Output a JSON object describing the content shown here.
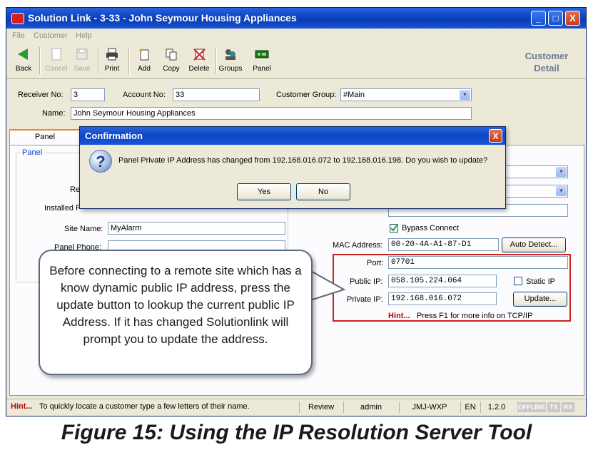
{
  "window": {
    "title": "Solution Link - 3-33 - John Seymour Housing Appliances",
    "min_btn": "_",
    "max_btn": "□",
    "close_btn": "X"
  },
  "menu": {
    "file": "File",
    "customer": "Customer",
    "help": "Help"
  },
  "toolbar": {
    "back": "Back",
    "cancel": "Cancel",
    "save": "Save",
    "print": "Print",
    "add": "Add",
    "copy": "Copy",
    "delete": "Delete",
    "groups": "Groups",
    "panel": "Panel",
    "customer_detail_1": "Customer",
    "customer_detail_2": "Detail"
  },
  "header_form": {
    "receiver_label": "Receiver No:",
    "receiver_value": "3",
    "account_label": "Account No:",
    "account_value": "33",
    "group_label": "Customer Group:",
    "group_value": "#Main",
    "name_label": "Name:",
    "name_value": "John Seymour Housing Appliances"
  },
  "tabs": {
    "panel": "Panel"
  },
  "panel_group": {
    "title": "Panel",
    "label_partial_1": "I",
    "label_partial_2": "Re",
    "installed_label": "Installed P",
    "site_name_label": "Site Name:",
    "site_name_value": "MyAlarm",
    "phone_label": "Panel Phone:",
    "phone_value": ""
  },
  "network": {
    "bypass_label": "Bypass Connect",
    "mac_label": "MAC Address:",
    "mac_value": "00-20-4A-A1-87-D1",
    "auto_detect": "Auto Detect...",
    "port_label": "Port:",
    "port_value": "07701",
    "public_ip_label": "Public IP:",
    "public_ip_value": "058.105.224.064",
    "static_ip_label": "Static IP",
    "private_ip_label": "Private IP:",
    "private_ip_value": "192.168.016.072",
    "update_btn": "Update...",
    "hint_label": "Hint...",
    "hint_text": "Press F1 for more info on TCP/IP"
  },
  "dialog": {
    "title": "Confirmation",
    "message": "Panel Private IP Address has changed from 192.168.016.072 to 192.168.016.198. Do you wish to update?",
    "yes": "Yes",
    "no": "No",
    "close": "X",
    "icon_glyph": "?"
  },
  "callout": {
    "text": "Before connecting to a remote site which has a know dynamic public IP address, press the update button to lookup the current public IP Address. If it has changed Solutionlink will prompt you to update the address."
  },
  "statusbar": {
    "hint_label": "Hint...",
    "hint_text": "To quickly locate a customer type a few letters of their name.",
    "mode": "Review",
    "user": "admin",
    "machine": "JMJ-WXP",
    "lang": "EN",
    "version": "1.2.0",
    "offline": "OFFLINE",
    "tx": "TX",
    "rx": "RX"
  },
  "caption": "Figure 15: Using the IP Resolution Server Tool",
  "colors": {
    "title_blue": "#0c46c8",
    "hint_red": "#c00000",
    "callout_border": "#5a6a7e",
    "highlight_box": "#d02020"
  }
}
